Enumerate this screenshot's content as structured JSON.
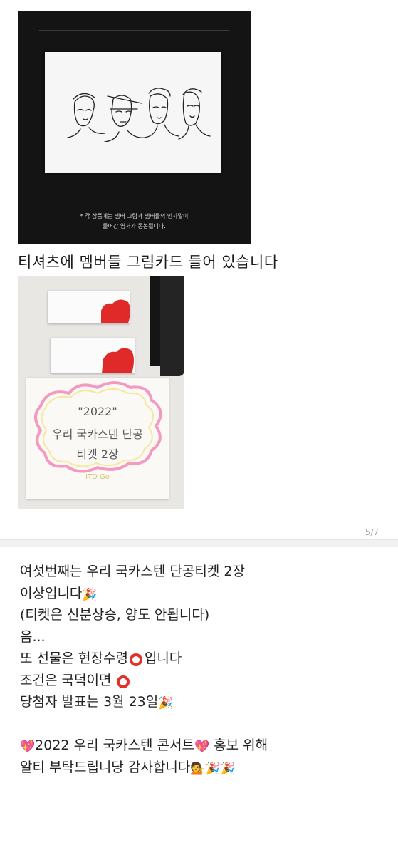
{
  "photo1": {
    "caption_line1": "* 각 상품에는 멤버 그림과 멤버들의 인사말이",
    "caption_line2": "들어간 엽서가 동봉됩니다."
  },
  "heading": "티셔츠에 멤버들 그림카드 들어 있습니다",
  "photo2": {
    "note_line1": "\"2022\"",
    "note_line2": "우리 국카스텐 단공",
    "note_line3": "티켓 2장",
    "corner_scribble": "ITD Go"
  },
  "page_indicator": "5/7",
  "post": {
    "line1": "여섯번째는 우리 국카스텐 단공티켓 2장",
    "line2": "이상입니다",
    "line3": "(티켓은 신분상승, 양도 안됩니다)",
    "line4": "음...",
    "line5a": "또 선물은 현장수령",
    "line5b": "입니다",
    "line6": "조건은 국덕이면 ",
    "line7": "당첨자 발표는 3월 23일",
    "line8": "2022 우리 국카스텐 콘서트",
    "line8b": " 홍보 위해",
    "line9": "알티 부탁드립니당 감사합니다"
  },
  "colors": {
    "circle": "#e0322b",
    "heart_emoji": "#e14c8e"
  },
  "icons": [
    "party-popper-icon",
    "red-circle-icon",
    "sparkling-heart-icon",
    "person-tipping-hand-icon"
  ]
}
